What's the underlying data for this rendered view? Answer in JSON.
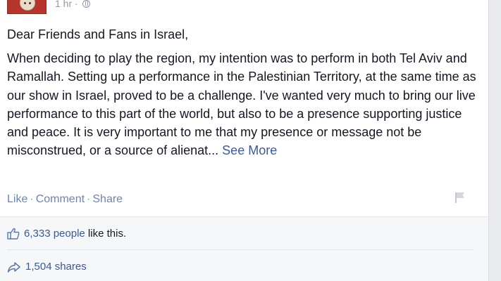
{
  "post": {
    "meta": {
      "time": "1 hr",
      "separator": "·",
      "privacy_icon": "globe-icon"
    },
    "greeting": "Dear Friends and Fans in Israel,",
    "body": "When deciding to play the region, my intention was to perform in both Tel Aviv and Ramallah. Setting up a performance in the Palestinian Territory, at the same time as our show in Israel, proved to be a challenge. I've wanted very much to bring our live performance to this part of the world, but also to be a presence supporting justice and peace. It is very important to me that my presence or message not be misconstrued, or a source of alienat...",
    "see_more": "See More"
  },
  "actions": {
    "like": "Like",
    "comment": "Comment",
    "share": "Share",
    "separator": "·",
    "flag_icon": "flag-icon"
  },
  "engagement": {
    "likes_count": "6,333 people",
    "likes_suffix": "like this.",
    "shares": "1,504 shares",
    "like_icon": "thumbs-up-icon",
    "share_icon": "share-arrow-icon"
  },
  "colors": {
    "link": "#3b5998",
    "action": "#6d84b4",
    "meta": "#9197a3",
    "text": "#141823",
    "panel": "#f6f7f9"
  }
}
